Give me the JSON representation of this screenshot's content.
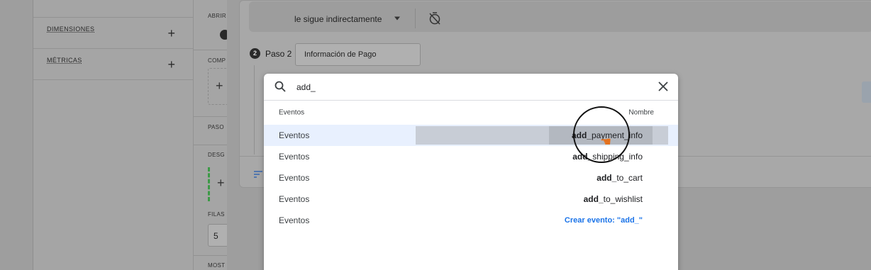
{
  "sidebar": {
    "items": [
      {
        "label": "DIMENSIONES",
        "action": "+"
      },
      {
        "label": "MÉTRICAS",
        "action": "+"
      }
    ]
  },
  "settings": {
    "labels": [
      "ABRIR",
      "COMP",
      "PASO",
      "DESG",
      "FILAS",
      "MOST"
    ],
    "rows_value": "5"
  },
  "filter": {
    "value": "le sigue indirectamente"
  },
  "step": {
    "badge": "2",
    "label": "Paso 2",
    "name": "Información de Pago"
  },
  "popup": {
    "search_value": "add_",
    "col_category": "Eventos",
    "col_name": "Nombre",
    "rows": [
      {
        "category": "Eventos",
        "match": "add_",
        "rest": "payment_info"
      },
      {
        "category": "Eventos",
        "match": "add_",
        "rest": "shipping_info"
      },
      {
        "category": "Eventos",
        "match": "add_",
        "rest": "to_cart"
      },
      {
        "category": "Eventos",
        "match": "add_",
        "rest": "to_wishlist"
      }
    ],
    "create_row": {
      "category": "Eventos",
      "label": "Crear evento: \"add_\""
    }
  },
  "icons": {
    "search": "search-icon",
    "close": "close-icon",
    "timer_off": "timer-off-icon",
    "cursor": "hand-pointer-icon"
  },
  "colors": {
    "accent": "#1a73e8",
    "highlight": "#e8f0fe",
    "cursor": "#e3711d"
  }
}
